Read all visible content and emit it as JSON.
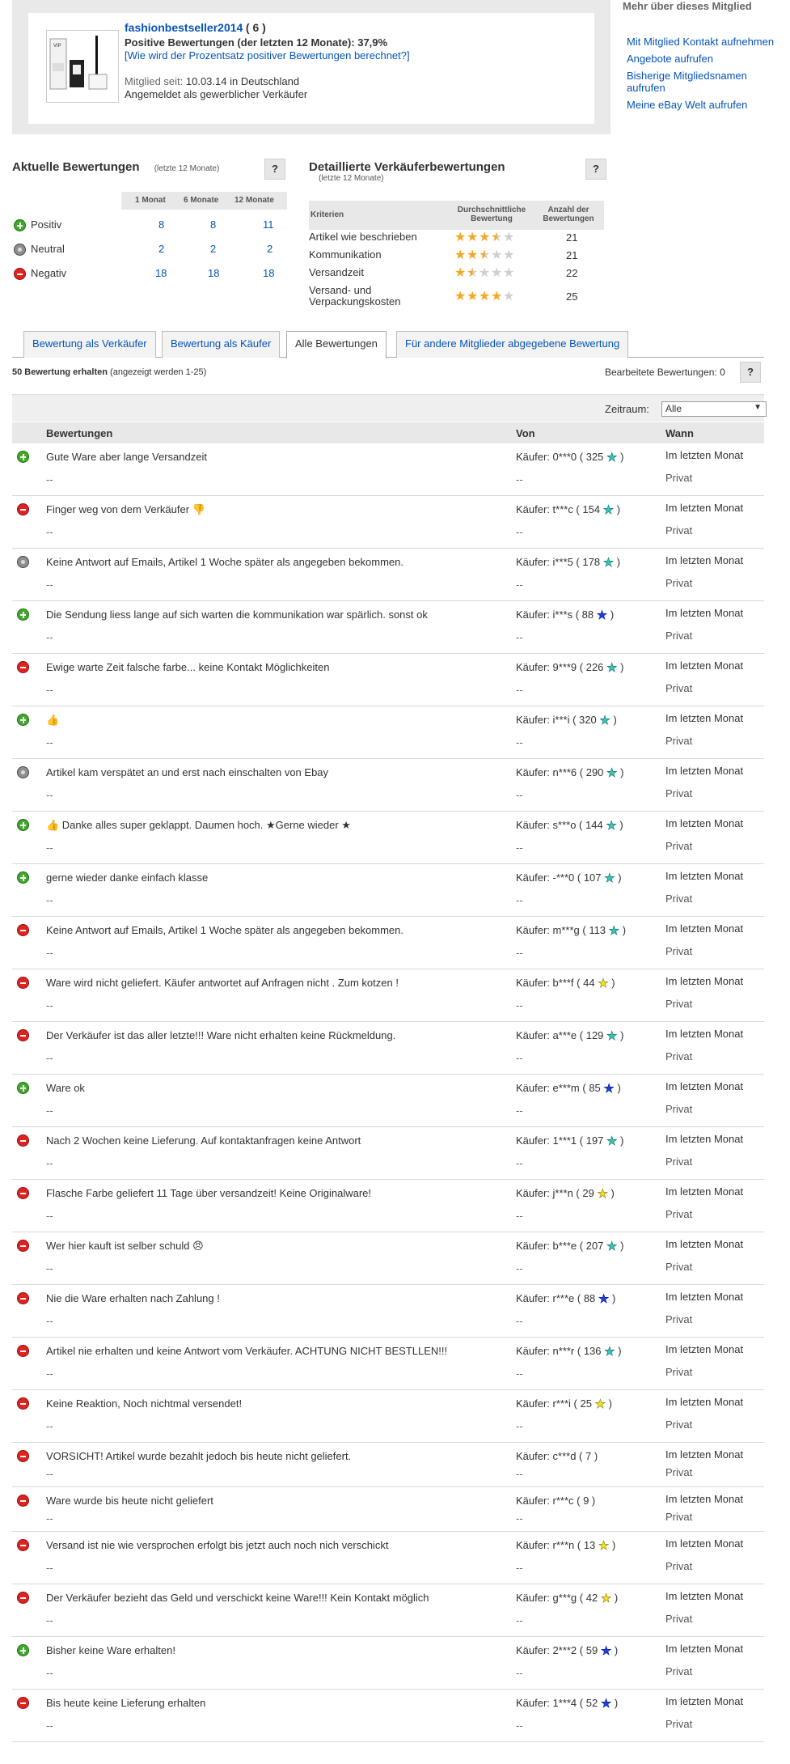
{
  "profile": {
    "member_name": "fashionbestseller2014",
    "score": "( 6 )",
    "positive_line": "Positive Bewertungen (der letzten 12 Monate): 37,9%",
    "calc_link": "[Wie wird der Prozentsatz positiver Bewertungen berechnet?]",
    "since_label": "Mitglied seit:",
    "since_value": "10.03.14 in Deutschland",
    "registered_as": "Angemeldet als gewerblicher Verkäufer"
  },
  "side": {
    "title": "Mehr über dieses Mitglied",
    "links": [
      "Mit Mitglied Kontakt aufnehmen",
      "Angebote aufrufen",
      "Bisherige Mitgliedsnamen aufrufen",
      "Meine eBay Welt aufrufen"
    ]
  },
  "current": {
    "title": "Aktuelle Bewertungen",
    "sub": "(letzte 12 Monate)",
    "help": "?",
    "col_1": "1 Monat",
    "col_6": "6 Monate",
    "col_12": "12 Monate",
    "rows": [
      {
        "type": "pos",
        "label": "Positiv",
        "m1": "8",
        "m6": "8",
        "m12": "11"
      },
      {
        "type": "neu",
        "label": "Neutral",
        "m1": "2",
        "m6": "2",
        "m12": "2"
      },
      {
        "type": "neg",
        "label": "Negativ",
        "m1": "18",
        "m6": "18",
        "m12": "18"
      }
    ]
  },
  "detailed": {
    "title": "Detaillierte Verkäuferbewertungen",
    "sub": "(letzte 12 Monate)",
    "help": "?",
    "col_criteria": "Kriterien",
    "col_avg": "Durchschnittliche Bewertung",
    "col_count": "Anzahl der Bewertungen",
    "rows": [
      {
        "label": "Artikel wie beschrieben",
        "rating": 3.5,
        "count": "21"
      },
      {
        "label": "Kommunikation",
        "rating": 2.5,
        "count": "21"
      },
      {
        "label": "Versandzeit",
        "rating": 1.5,
        "count": "22"
      },
      {
        "label": "Versand- und Verpackungskosten",
        "rating": 4,
        "count": "25"
      }
    ]
  },
  "tabs": [
    {
      "label": "Bewertung als Verkäufer",
      "active": false
    },
    {
      "label": "Bewertung als Käufer",
      "active": false
    },
    {
      "label": "Alle Bewertungen",
      "active": true
    },
    {
      "label": "Für andere Mitglieder abgegebene Bewertung",
      "active": false
    }
  ],
  "list": {
    "count_bold": "50 Bewertung erhalten",
    "count_rest": "(angezeigt werden 1-25)",
    "edited": "Bearbeitete Bewertungen: 0",
    "help": "?",
    "filter_label": "Zeitraum:",
    "filter_value": "Alle",
    "col_feedback": "Bewertungen",
    "col_from": "Von",
    "col_when": "Wann"
  },
  "feedback": [
    {
      "type": "pos",
      "comment": "Gute Ware aber lange Versandzeit",
      "buyer": "Käufer: 0***0 ( 325",
      "star": "turquoise",
      "when": "Im letzten Monat",
      "price": "Privat",
      "reply": "--",
      "reply2": "--"
    },
    {
      "type": "neg",
      "comment": "Finger weg von dem Verkäufer 👎",
      "buyer": "Käufer: t***c ( 154",
      "star": "turquoise",
      "when": "Im letzten Monat",
      "price": "Privat",
      "reply": "--",
      "reply2": "--"
    },
    {
      "type": "neu",
      "comment": "Keine Antwort auf Emails, Artikel 1 Woche später als angegeben bekommen.",
      "buyer": "Käufer: i***5 ( 178",
      "star": "turquoise",
      "when": "Im letzten Monat",
      "price": "Privat",
      "reply": "--",
      "reply2": "--"
    },
    {
      "type": "pos",
      "comment": "Die Sendung liess lange auf sich warten die kommunikation war spärlich. sonst ok",
      "buyer": "Käufer: i***s ( 88",
      "star": "blue",
      "when": "Im letzten Monat",
      "price": "Privat",
      "reply": "--",
      "reply2": "--"
    },
    {
      "type": "neg",
      "comment": "Ewige warte Zeit falsche farbe... keine Kontakt Möglichkeiten",
      "buyer": "Käufer: 9***9 ( 226",
      "star": "turquoise",
      "when": "Im letzten Monat",
      "price": "Privat",
      "reply": "--",
      "reply2": "--"
    },
    {
      "type": "pos",
      "comment": "👍",
      "buyer": "Käufer: i***i ( 320",
      "star": "turquoise",
      "when": "Im letzten Monat",
      "price": "Privat",
      "reply": "--",
      "reply2": "--"
    },
    {
      "type": "neu",
      "comment": "Artikel kam verspätet an und erst nach einschalten von Ebay",
      "buyer": "Käufer: n***6 ( 290",
      "star": "turquoise",
      "when": "Im letzten Monat",
      "price": "Privat",
      "reply": "--",
      "reply2": "--"
    },
    {
      "type": "pos",
      "comment": "👍 Danke alles super geklappt. Daumen hoch. ★Gerne wieder ★",
      "buyer": "Käufer: s***o ( 144",
      "star": "turquoise",
      "when": "Im letzten Monat",
      "price": "Privat",
      "reply": "--",
      "reply2": "--"
    },
    {
      "type": "pos",
      "comment": "gerne wieder danke einfach klasse",
      "buyer": "Käufer: -***0 ( 107",
      "star": "turquoise",
      "when": "Im letzten Monat",
      "price": "Privat",
      "reply": "--",
      "reply2": "--"
    },
    {
      "type": "neg",
      "comment": "Keine Antwort auf Emails, Artikel 1 Woche später als angegeben bekommen.",
      "buyer": "Käufer: m***g ( 113",
      "star": "turquoise",
      "when": "Im letzten Monat",
      "price": "Privat",
      "reply": "--",
      "reply2": "--"
    },
    {
      "type": "neg",
      "comment": "Ware wird nicht geliefert. Käufer antwortet auf Anfragen nicht . Zum kotzen !",
      "buyer": "Käufer: b***f ( 44",
      "star": "yellow",
      "when": "Im letzten Monat",
      "price": "Privat",
      "reply": "--",
      "reply2": "--"
    },
    {
      "type": "neg",
      "comment": "Der Verkäufer ist das aller letzte!!! Ware nicht erhalten keine Rückmeldung.",
      "buyer": "Käufer: a***e ( 129",
      "star": "turquoise",
      "when": "Im letzten Monat",
      "price": "Privat",
      "reply": "--",
      "reply2": "--"
    },
    {
      "type": "pos",
      "comment": "Ware ok",
      "buyer": "Käufer: e***m ( 85",
      "star": "blue",
      "when": "Im letzten Monat",
      "price": "Privat",
      "reply": "--",
      "reply2": "--"
    },
    {
      "type": "neg",
      "comment": "Nach 2 Wochen keine Lieferung. Auf kontaktanfragen keine Antwort",
      "buyer": "Käufer: 1***1 ( 197",
      "star": "turquoise",
      "when": "Im letzten Monat",
      "price": "Privat",
      "reply": "--",
      "reply2": "--"
    },
    {
      "type": "neg",
      "comment": "Flasche Farbe geliefert 11 Tage über versandzeit! Keine Originalware!",
      "buyer": "Käufer: j***n ( 29",
      "star": "yellow",
      "when": "Im letzten Monat",
      "price": "Privat",
      "reply": "--",
      "reply2": "--"
    },
    {
      "type": "neg",
      "comment": "Wer hier kauft ist selber schuld 😠",
      "buyer": "Käufer: b***e ( 207",
      "star": "turquoise",
      "when": "Im letzten Monat",
      "price": "Privat",
      "reply": "--",
      "reply2": "--"
    },
    {
      "type": "neg",
      "comment": "Nie die Ware erhalten nach Zahlung !",
      "buyer": "Käufer: r***e ( 88",
      "star": "blue",
      "when": "Im letzten Monat",
      "price": "Privat",
      "reply": "--",
      "reply2": "--"
    },
    {
      "type": "neg",
      "comment": "Artikel nie erhalten und keine Antwort vom Verkäufer. ACHTUNG NICHT BESTLLEN!!!",
      "buyer": "Käufer: n***r ( 136",
      "star": "turquoise",
      "when": "Im letzten Monat",
      "price": "Privat",
      "reply": "--",
      "reply2": "--"
    },
    {
      "type": "neg",
      "comment": "Keine Reaktion, Noch nichtmal versendet!",
      "buyer": "Käufer: r***i ( 25",
      "star": "yellow",
      "when": "Im letzten Monat",
      "price": "Privat",
      "reply": "--",
      "reply2": "--"
    },
    {
      "type": "neg",
      "comment": "VORSICHT! Artikel wurde bezahlt jedoch bis heute nicht geliefert.",
      "buyer": "Käufer: c***d ( 7 )",
      "star": "",
      "when": "Im letzten Monat",
      "price": "Privat",
      "reply": "--",
      "reply2": "--"
    },
    {
      "type": "neg",
      "comment": "Ware wurde bis heute nicht geliefert",
      "buyer": "Käufer: r***c ( 9 )",
      "star": "",
      "when": "Im letzten Monat",
      "price": "Privat",
      "reply": "--",
      "reply2": "--"
    },
    {
      "type": "neg",
      "comment": "Versand ist nie wie versprochen erfolgt bis jetzt auch noch nich verschickt",
      "buyer": "Käufer: r***n ( 13",
      "star": "yellow",
      "when": "Im letzten Monat",
      "price": "Privat",
      "reply": "--",
      "reply2": "--"
    },
    {
      "type": "neg",
      "comment": "Der Verkäufer bezieht das Geld und verschickt keine Ware!!! Kein Kontakt möglich",
      "buyer": "Käufer: g***g ( 42",
      "star": "yellow",
      "when": "Im letzten Monat",
      "price": "Privat",
      "reply": "--",
      "reply2": "--"
    },
    {
      "type": "pos",
      "comment": "Bisher keine Ware erhalten!",
      "buyer": "Käufer: 2***2 ( 59",
      "star": "blue",
      "when": "Im letzten Monat",
      "price": "Privat",
      "reply": "--",
      "reply2": "--"
    },
    {
      "type": "neg",
      "comment": "Bis heute keine Lieferung erhalten",
      "buyer": "Käufer: 1***4 ( 52",
      "star": "blue",
      "when": "Im letzten Monat",
      "price": "Privat",
      "reply": "--",
      "reply2": "--"
    }
  ]
}
